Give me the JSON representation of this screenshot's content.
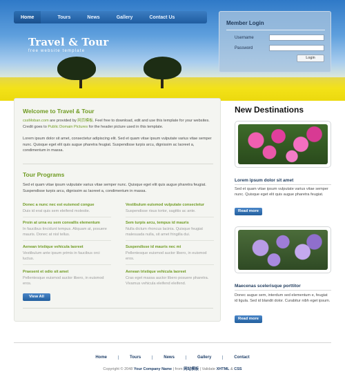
{
  "header": {
    "nav": [
      "Home",
      "Tours",
      "News",
      "Gallery",
      "Contact Us"
    ],
    "brand_title": "Travel & Tour",
    "brand_subtitle": "free website template"
  },
  "login": {
    "title": "Member Login",
    "username_label": "Username",
    "password_label": "Password",
    "button": "Login"
  },
  "welcome": {
    "title": "Welcome to Travel & Tour",
    "intro_link1": "cssMoban.com",
    "intro_mid": " are provided by ",
    "intro_link2": "网页模板",
    "intro_rest": ". Feel free to download, edit and use this template for your websites. Credit goes to ",
    "intro_link3": "Public Domain Pictures",
    "intro_end": " for the header picture used in this template.",
    "body": "Lorem ipsum dolor sit amet, consectetur adipiscing elit. Sed et quam vitae ipsum vulputate varius vitae semper nunc. Quisque eget elit quis augue pharetra feugiat. Suspendisse turpis arcu, dignissim ac laoreet a, condimentum in massa."
  },
  "programs": {
    "title": "Tour Programs",
    "intro": "Sed et quam vitae ipsum vulputate varius vitae semper nunc. Quisque eget elit quis augue pharetra feugiat. Suspendisse turpis arcu, dignissim ac laoreet a, condimentum in massa.",
    "items": [
      {
        "title": "Donec a nunc nec est euismod congue",
        "desc": "Duis id erat quis sem eleifend molestie."
      },
      {
        "title": "Vestibulum euismod vulputate consectetur",
        "desc": "Suspendisse risus tortor, sagittis ac ante."
      },
      {
        "title": "Proin at urna eu sem convallis elementum",
        "desc": "In faucibus tincidunt tempus. Aliquam at, posuere mauris. Donec at nisl tellus."
      },
      {
        "title": "Sem turpis arcu, tempus id mauris",
        "desc": "Nulla dictum rhoncus lacinia. Quisque feugiat malesuada nulla, sit amet fringilla dui."
      },
      {
        "title": "Aenean tristique vehicula laoreet",
        "desc": "Vestibulum ante ipsum primis in faucibus orci luctus."
      },
      {
        "title": "Suspendisse id mauris nec mi",
        "desc": "Pellentesque euismod auctor libero, in euismod eros."
      },
      {
        "title": "Praesent et odio sit amet",
        "desc": "Pellentesque euismod auctor libero, in euismod eros."
      },
      {
        "title": "Aenean tristique vehicula laoreet",
        "desc": "Cras eget massa auctor libero posuere pharetra. Vivamus vehicula eleifend eleifend."
      }
    ],
    "view_all": "View All"
  },
  "destinations": {
    "title": "New Destinations",
    "items": [
      {
        "title": "Lorem ipsum dolor sit amet",
        "text": "Sed et quam vitae ipsum vulputate varius vitae semper nunc. Quisque eget elit quis augue pharetra feugiat.",
        "button": "Read more"
      },
      {
        "title": "Maecenas scelerisque porttitor",
        "text": "Donec augue sem, interdum sed elementum e, feugiat id ligula. Sed id blandit dolor. Curabitur nibh eget ipsum.",
        "button": "Read more"
      }
    ]
  },
  "footer": {
    "nav": [
      "Home",
      "Tours",
      "News",
      "Gallery",
      "Contact"
    ],
    "copyright_prefix": "Copyright © 2048 ",
    "company": "Your Company Name",
    "from": " | from ",
    "from_link": "网站模板",
    "valid": " | Validate ",
    "xhtml": "XHTML",
    "amp": " & ",
    "css": "CSS"
  },
  "colors": {
    "accent_green": "#6f9b22",
    "nav_blue": "#1f5c9f",
    "button_blue": "#225f9e"
  }
}
